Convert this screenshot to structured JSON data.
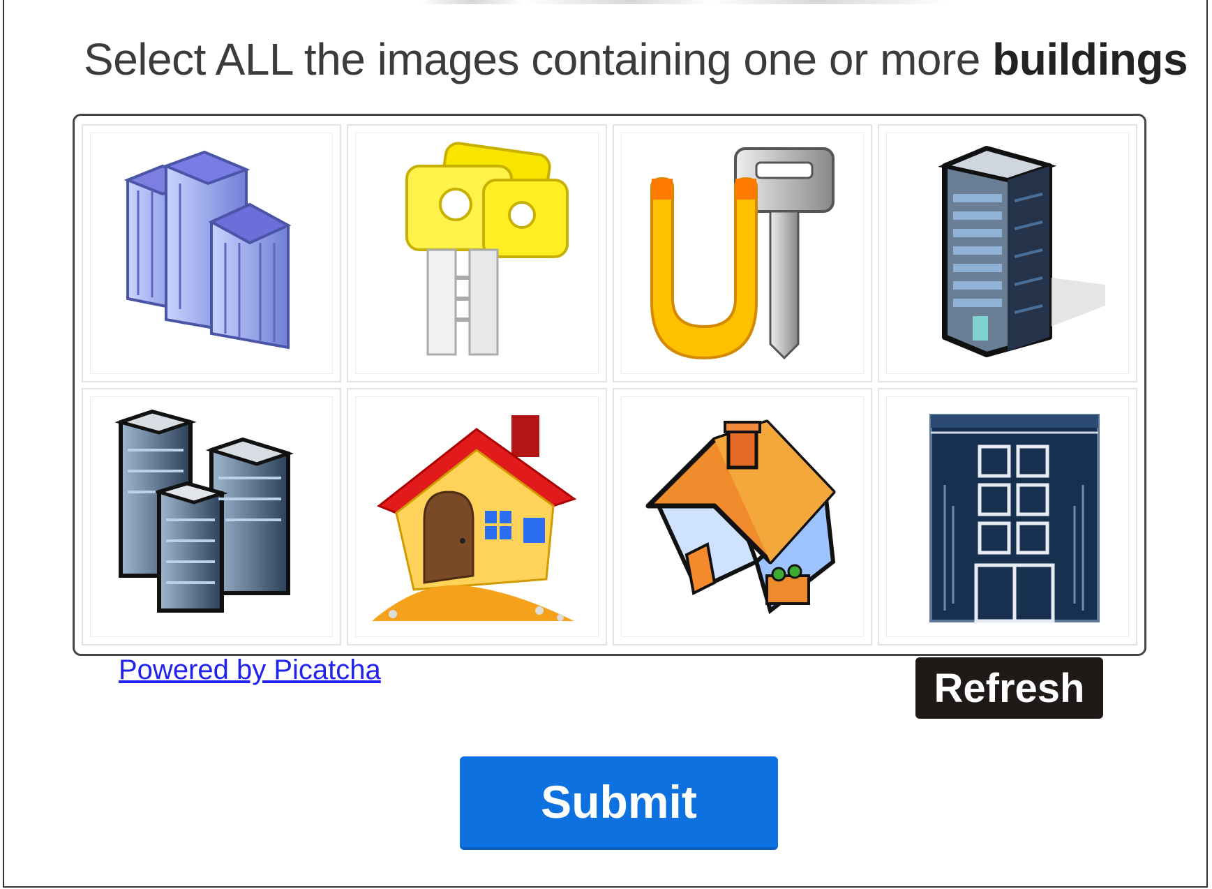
{
  "captcha": {
    "instruction_prefix": "Select ALL the images containing one or more ",
    "instruction_keyword": "buildings",
    "tiles": [
      {
        "icon": "office-buildings-icon"
      },
      {
        "icon": "yellow-keys-icon"
      },
      {
        "icon": "magnet-and-key-icon"
      },
      {
        "icon": "skyscraper-icon"
      },
      {
        "icon": "city-buildings-icon"
      },
      {
        "icon": "house-red-roof-icon"
      },
      {
        "icon": "house-orange-roof-icon"
      },
      {
        "icon": "building-facade-icon"
      }
    ],
    "powered_by": "Powered by Picatcha",
    "refresh_label": "Refresh"
  },
  "form": {
    "submit_label": "Submit"
  },
  "colors": {
    "submit_bg": "#0d72e0",
    "refresh_bg": "#1f1a17",
    "link": "#2222ee"
  }
}
